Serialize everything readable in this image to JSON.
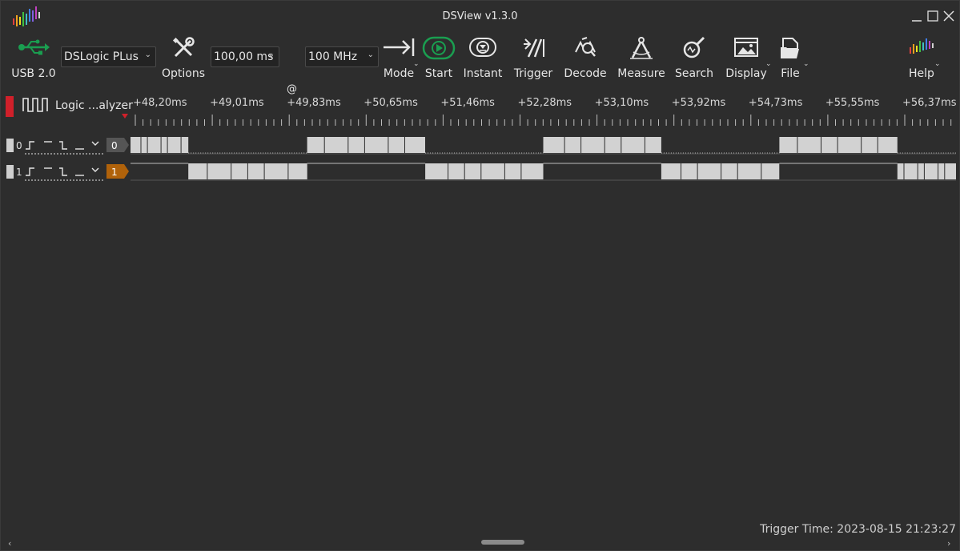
{
  "window": {
    "title": "DSView v1.3.0",
    "accent": "#1a9e50"
  },
  "toolbar": {
    "usb_label": "USB 2.0",
    "device": "DSLogic PLus",
    "options_label": "Options",
    "duration": "100,00 ms",
    "at": "@",
    "samplerate": "100 MHz",
    "mode_label": "Mode",
    "start_label": "Start",
    "instant_label": "Instant",
    "trigger_label": "Trigger",
    "decode_label": "Decode",
    "measure_label": "Measure",
    "search_label": "Search",
    "display_label": "Display",
    "file_label": "File",
    "help_label": "Help"
  },
  "ruler": {
    "group_label": "Logic ...alyzer",
    "ticks": [
      "+48,20ms",
      "+49,01ms",
      "+49,83ms",
      "+50,65ms",
      "+51,46ms",
      "+52,28ms",
      "+53,10ms",
      "+53,92ms",
      "+54,73ms",
      "+55,55ms",
      "+56,37ms"
    ]
  },
  "channels": [
    {
      "index": "0",
      "tag": "0",
      "tag_color": "#555555",
      "segments": [
        [
          0.0,
          0.07,
          1
        ],
        [
          0.07,
          0.214,
          0
        ],
        [
          0.214,
          0.357,
          1
        ],
        [
          0.357,
          0.5,
          0
        ],
        [
          0.5,
          0.643,
          1
        ],
        [
          0.643,
          0.786,
          0
        ],
        [
          0.786,
          0.929,
          1
        ],
        [
          0.929,
          1.0,
          0
        ]
      ]
    },
    {
      "index": "1",
      "tag": "1",
      "tag_color": "#b0620a",
      "segments": [
        [
          0.0,
          0.07,
          0
        ],
        [
          0.07,
          0.214,
          1
        ],
        [
          0.214,
          0.357,
          0
        ],
        [
          0.357,
          0.5,
          1
        ],
        [
          0.5,
          0.643,
          0
        ],
        [
          0.643,
          0.786,
          1
        ],
        [
          0.786,
          0.929,
          0
        ],
        [
          0.929,
          1.0,
          1
        ]
      ]
    }
  ],
  "status": {
    "trigger_time": "Trigger Time: 2023-08-15 21:23:27"
  }
}
